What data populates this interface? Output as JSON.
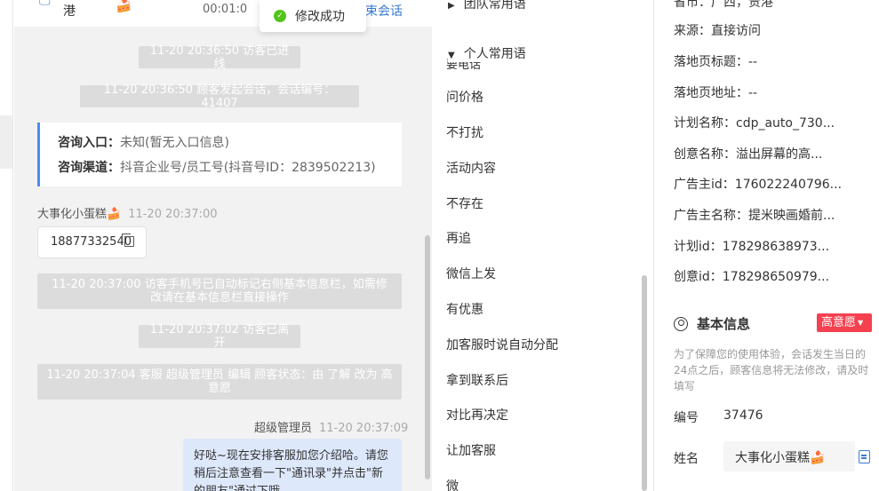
{
  "chat": {
    "header": {
      "visitor_name": "港",
      "visitor_emoji": "🍰",
      "timer": "00:01:0",
      "end_session": "结束会话"
    },
    "toast": "修改成功",
    "system_messages": [
      "11-20 20:36:50 访客已进线",
      "11-20 20:36:50 顾客发起会话，会话编号：41407",
      "11-20 20:37:00 访客手机号已自动标记右侧基本信息栏，如需修改请在基本信息栏直接操作",
      "11-20 20:37:02 访客已离开",
      "11-20 20:37:04 客服 超级管理员 编辑 顾客状态：由 了解 改为 高意愿"
    ],
    "info_card": {
      "entry_label": "咨询入口：",
      "entry_value": "未知(暂无入口信息)",
      "channel_label": "咨询渠道：",
      "channel_value": "抖音企业号/员工号(抖音号ID：2839502213)"
    },
    "visitor_msg": {
      "sender": "大事化小蛋糕🍰",
      "time": "11-20 20:37:00",
      "phone": "18877332540"
    },
    "agent_msg": {
      "sender": "超级管理员",
      "time": "11-20 20:37:09",
      "text": "好哒~现在安排客服加您介绍哈。请您稍后注意查看一下\"通讯录\"并点击\"新的朋友\"通过下哦"
    }
  },
  "phrases": {
    "team_group": "团队常用语",
    "personal_group": "个人常用语",
    "partial_item": "要电话",
    "items": [
      "问价格",
      "不打扰",
      "活动内容",
      "不存在",
      "再追",
      "微信上发",
      "有优惠",
      "加客服时说自动分配",
      "拿到联系后",
      "对比再决定",
      "让加客服",
      "微"
    ]
  },
  "visitor_info": {
    "top_partial": "省市：广西，贵港",
    "rows": [
      {
        "label": "来源：",
        "value": "直接访问"
      },
      {
        "label": "落地页标题：",
        "value": "--"
      },
      {
        "label": "落地页地址：",
        "value": "--"
      },
      {
        "label": "计划名称：",
        "value": "cdp_auto_730..."
      },
      {
        "label": "创意名称：",
        "value": "溢出屏幕的高..."
      },
      {
        "label": "广告主id：",
        "value": "176022240796..."
      },
      {
        "label": "广告主名称：",
        "value": "提米映画婚前..."
      },
      {
        "label": "计划id：",
        "value": "178298638973..."
      },
      {
        "label": "创意id：",
        "value": "178298650979..."
      }
    ],
    "basic_title": "基本信息",
    "intent_badge": "高意愿",
    "notice": "为了保障您的使用体验，会话发生当日的24点之后，顾客信息将无法修改，请及时填写",
    "id_label": "编号",
    "id_value": "37476",
    "name_label": "姓名",
    "name_value": "大事化小蛋糕🍰"
  },
  "colors": {
    "accent": "#3a7bd5",
    "success": "#52c41a",
    "badge": "#f5404f",
    "agent_bubble": "#dde8fb",
    "system_msg_bg": "#dcdcdc"
  }
}
